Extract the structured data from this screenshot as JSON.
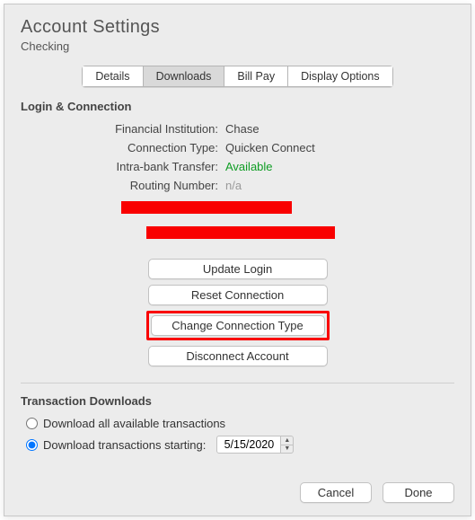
{
  "header": {
    "title": "Account Settings",
    "subtitle": "Checking"
  },
  "tabs": {
    "details": "Details",
    "downloads": "Downloads",
    "billpay": "Bill Pay",
    "display": "Display Options"
  },
  "login": {
    "section_title": "Login & Connection",
    "fi_label": "Financial Institution:",
    "fi_value": "Chase",
    "ct_label": "Connection Type:",
    "ct_value": "Quicken Connect",
    "ibt_label": "Intra-bank Transfer:",
    "ibt_value": "Available",
    "rn_label": "Routing Number:",
    "rn_value": "n/a"
  },
  "buttons": {
    "update_login": "Update Login",
    "reset_connection": "Reset Connection",
    "change_connection": "Change Connection Type",
    "disconnect": "Disconnect Account"
  },
  "trans": {
    "section_title": "Transaction Downloads",
    "opt_all": "Download all available transactions",
    "opt_start": "Download transactions starting:",
    "date_value": "5/15/2020"
  },
  "footer": {
    "cancel": "Cancel",
    "done": "Done"
  }
}
